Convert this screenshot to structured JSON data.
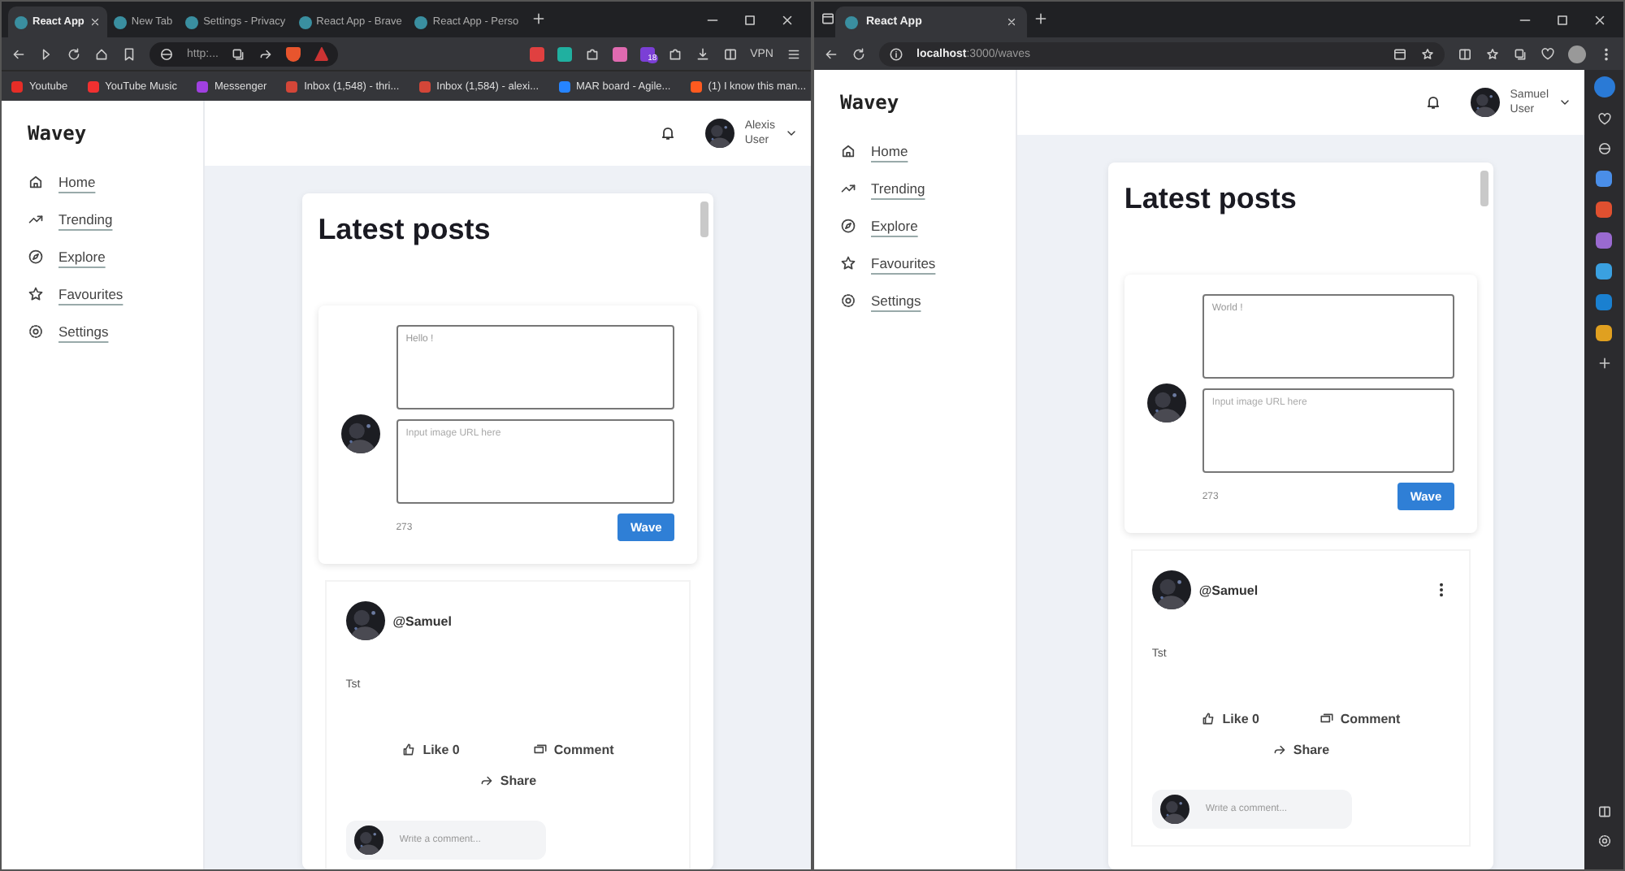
{
  "windows": [
    {
      "kind": "brave",
      "tabs": [
        {
          "label": "React App",
          "selected": true
        },
        {
          "label": "New Tab",
          "selected": false
        },
        {
          "label": "Settings - Privacy",
          "selected": false
        },
        {
          "label": "React App - Brave",
          "selected": false
        },
        {
          "label": "React App - Perso",
          "selected": false
        }
      ],
      "address": "http:...",
      "extension_badge": "18",
      "vpn_label": "VPN",
      "bookmarks": [
        {
          "label": "Youtube",
          "color": "#e52d27"
        },
        {
          "label": "YouTube Music",
          "color": "#f03030"
        },
        {
          "label": "Messenger",
          "color": "#a040e0"
        },
        {
          "label": "Inbox (1,548) - thri...",
          "color": "#d44638"
        },
        {
          "label": "Inbox (1,584) - alexi...",
          "color": "#d44638"
        },
        {
          "label": "MAR board - Agile...",
          "color": "#2684ff"
        },
        {
          "label": "(1) I know this man...",
          "color": "#ff5a1f"
        }
      ],
      "app": {
        "logo": "Wavey",
        "nav": [
          "Home",
          "Trending",
          "Explore",
          "Favourites",
          "Settings"
        ],
        "user": {
          "name": "Alexis",
          "role": "User"
        },
        "feed_title": "Latest posts",
        "composer": {
          "text_value": "Hello !",
          "image_placeholder": "Input image URL here",
          "counter": "273",
          "button": "Wave"
        },
        "post": {
          "author": "@Samuel",
          "menu": false,
          "text": "Tst",
          "like": "Like 0",
          "comment": "Comment",
          "share": "Share",
          "comment_placeholder": "Write a comment..."
        }
      }
    },
    {
      "kind": "edge",
      "tabs": [
        {
          "label": "React App",
          "selected": true
        }
      ],
      "address": "**localhost**:3000/waves",
      "app": {
        "logo": "Wavey",
        "nav": [
          "Home",
          "Trending",
          "Explore",
          "Favourites",
          "Settings"
        ],
        "user": {
          "name": "Samuel",
          "role": "User"
        },
        "feed_title": "Latest posts",
        "composer": {
          "text_value": "World !",
          "image_placeholder": "Input image URL here",
          "counter": "273",
          "button": "Wave"
        },
        "post": {
          "author": "@Samuel",
          "menu": true,
          "text": "Tst",
          "like": "Like 0",
          "comment": "Comment",
          "share": "Share",
          "comment_placeholder": "Write a comment..."
        }
      }
    }
  ]
}
